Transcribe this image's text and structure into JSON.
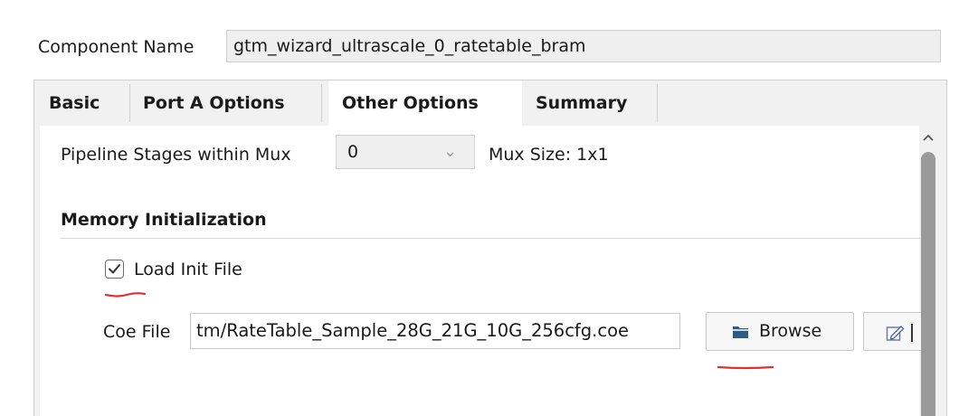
{
  "component": {
    "label": "Component Name",
    "value": "gtm_wizard_ultrascale_0_ratetable_bram"
  },
  "tabs": [
    {
      "label": "Basic",
      "active": false
    },
    {
      "label": "Port A Options",
      "active": false
    },
    {
      "label": "Other Options",
      "active": true
    },
    {
      "label": "Summary",
      "active": false
    }
  ],
  "pipeline": {
    "label": "Pipeline Stages within Mux",
    "selected": "0",
    "mux_size": "Mux Size: 1x1"
  },
  "memory_init": {
    "title": "Memory Initialization",
    "load_init_label": "Load Init File",
    "load_init_checked": true,
    "coe_label": "Coe File",
    "coe_value": "tm/RateTable_Sample_28G_21G_10G_256cfg.coe",
    "browse_label": "Browse"
  },
  "icons": {
    "browse": "folder-icon",
    "edit": "edit-icon",
    "dropdown": "chevron-down-icon",
    "scroll_up": "chevron-up-icon"
  },
  "colors": {
    "annotation": "#e03030",
    "field_bg": "#efefef",
    "folder_icon": "#2f5b87"
  }
}
